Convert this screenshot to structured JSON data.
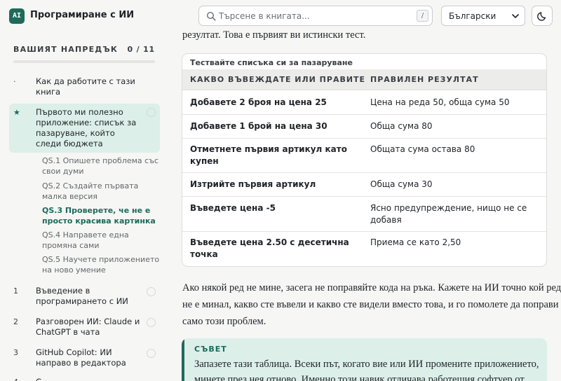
{
  "app": {
    "logo_text": "AI",
    "title": "Програмиране с ИИ"
  },
  "search": {
    "placeholder": "Търсене в книгата...",
    "shortcut": "/"
  },
  "language": {
    "selected": "Български"
  },
  "icons": {
    "search": "search-icon",
    "theme": "moon-icon",
    "language": "chevron-down-icon"
  },
  "colors": {
    "accent": "#1e6a5b",
    "accent_soft": "#dcefe9"
  },
  "sidebar": {
    "progress_title": "ВАШИЯТ НАПРЕДЪК",
    "progress_count": "0 / 11",
    "progress_fraction": 0,
    "chapters": [
      {
        "num": "·",
        "label": "Как да работите с тази книга"
      },
      {
        "num": "★",
        "label": "Първото ми полезно приложение: списък за пазаруване, който следи бюджета"
      },
      {
        "num": "1",
        "label": "Въведение в програмирането с ИИ"
      },
      {
        "num": "2",
        "label": "Разговорен ИИ: Claude и ChatGPT в чата"
      },
      {
        "num": "3",
        "label": "GitHub Copilot: ИИ направо в редактора"
      },
      {
        "num": "4",
        "label": "С"
      }
    ],
    "sections": [
      {
        "label": "QS.1  Опишете проблема със свои думи"
      },
      {
        "label": "QS.2  Създайте първата малка версия"
      },
      {
        "label": "QS.3  Проверете, че не е просто красива картинка"
      },
      {
        "label": "QS.4  Направете една промяна сами"
      },
      {
        "label": "QS.5  Научете приложението на ново умение"
      }
    ]
  },
  "content": {
    "intro_line": "резултат. Това е първият ви истински тест.",
    "table": {
      "caption": "Тествайте списъка си за пазаруване",
      "headers": [
        "КАКВО ВЪВЕЖДАТЕ ИЛИ ПРАВИТЕ",
        "ПРАВИЛЕН РЕЗУЛТАТ"
      ],
      "rows": [
        [
          "Добавете 2 броя на цена 25",
          "Цена на реда 50, обща сума 50"
        ],
        [
          "Добавете 1 брой на цена 30",
          "Обща сума 80"
        ],
        [
          "Отметнете първия артикул като купен",
          "Общата сума остава 80"
        ],
        [
          "Изтрийте първия артикул",
          "Обща сума 30"
        ],
        [
          "Въведете цена -5",
          "Ясно предупреждение, нищо не се добавя"
        ],
        [
          "Въведете цена 2.50 с десетична точка",
          "Приема се като 2,50"
        ]
      ]
    },
    "after_table": [
      "Ако някой ред не мине, засега не поправяйте кода на ръка. Кажете на ИИ точно кой ред",
      "не е минал, какво сте въвели и какво сте видели вместо това, и го помолете да поправи",
      "само този проблем."
    ],
    "tip": {
      "title": "СЪВЕТ",
      "lines": [
        "Запазете тази таблица. Всеки път, когато вие или ИИ промените приложението,",
        "минете през нея отново. Именно този навик отличава работещия софтуер от"
      ]
    }
  }
}
